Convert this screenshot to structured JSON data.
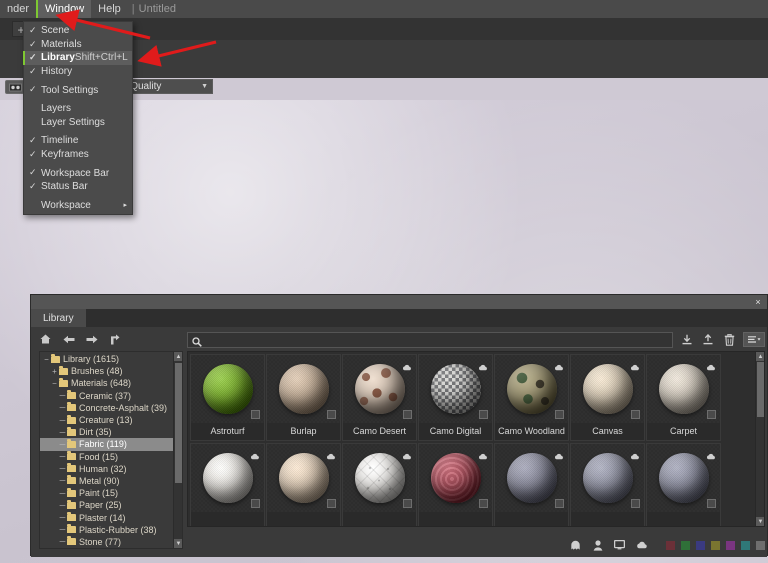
{
  "menubar": {
    "items": [
      {
        "label": "nder",
        "active": false
      },
      {
        "label": "Window",
        "active": true
      },
      {
        "label": "Help",
        "active": false
      }
    ],
    "separator": "|",
    "document_title": "Untitled"
  },
  "toolbar": {
    "new_tab_label": "+",
    "camera_icon": "camera-icon",
    "quality_dropdown": {
      "value": "ll Quality",
      "caret": "▼"
    }
  },
  "window_menu": {
    "checkmark": "✓",
    "submenu_arrow": "▸",
    "items": [
      {
        "label": "Scene",
        "checked": true,
        "shortcut": "",
        "highlight": false,
        "separator_after": false
      },
      {
        "label": "Materials",
        "checked": true,
        "shortcut": "",
        "highlight": false,
        "separator_after": false
      },
      {
        "label": "Library",
        "checked": true,
        "shortcut": "Shift+Ctrl+L",
        "highlight": true,
        "separator_after": false
      },
      {
        "label": "History",
        "checked": true,
        "shortcut": "",
        "highlight": false,
        "separator_after": true
      },
      {
        "label": "Tool Settings",
        "checked": true,
        "shortcut": "",
        "highlight": false,
        "separator_after": true
      },
      {
        "label": "Layers",
        "checked": false,
        "shortcut": "",
        "highlight": false,
        "separator_after": false
      },
      {
        "label": "Layer Settings",
        "checked": false,
        "shortcut": "",
        "highlight": false,
        "separator_after": true
      },
      {
        "label": "Timeline",
        "checked": true,
        "shortcut": "",
        "highlight": false,
        "separator_after": false
      },
      {
        "label": "Keyframes",
        "checked": true,
        "shortcut": "",
        "highlight": false,
        "separator_after": true
      },
      {
        "label": "Workspace Bar",
        "checked": true,
        "shortcut": "",
        "highlight": false,
        "separator_after": false
      },
      {
        "label": "Status Bar",
        "checked": true,
        "shortcut": "",
        "highlight": false,
        "separator_after": true
      },
      {
        "label": "Workspace",
        "checked": false,
        "shortcut": "",
        "highlight": false,
        "submenu": true,
        "separator_after": false
      }
    ]
  },
  "annotations": {
    "arrow_color": "#e01b1b",
    "arrow_1_target": "Window menu",
    "arrow_2_target": "Library menu item"
  },
  "library_window": {
    "close_label": "×",
    "tab_label": "Library",
    "nav_icons": [
      {
        "name": "home-icon"
      },
      {
        "name": "back-arrow-icon"
      },
      {
        "name": "forward-arrow-icon"
      },
      {
        "name": "up-level-icon"
      }
    ],
    "search": {
      "value": "",
      "placeholder": "",
      "icon": "search-icon"
    },
    "actions": [
      {
        "name": "download-icon"
      },
      {
        "name": "upload-icon"
      },
      {
        "name": "trash-icon"
      },
      {
        "name": "view-options-icon"
      }
    ],
    "tree": [
      {
        "label": "Library (1615)",
        "depth": 0,
        "twist": "−",
        "selected": false
      },
      {
        "label": "Brushes (48)",
        "depth": 1,
        "twist": "+",
        "selected": false
      },
      {
        "label": "Materials (648)",
        "depth": 1,
        "twist": "−",
        "selected": false
      },
      {
        "label": "Ceramic (37)",
        "depth": 2,
        "twist": "",
        "selected": false
      },
      {
        "label": "Concrete-Asphalt (39)",
        "depth": 2,
        "twist": "",
        "selected": false
      },
      {
        "label": "Creature (13)",
        "depth": 2,
        "twist": "",
        "selected": false
      },
      {
        "label": "Dirt (35)",
        "depth": 2,
        "twist": "",
        "selected": false
      },
      {
        "label": "Fabric (119)",
        "depth": 2,
        "twist": "",
        "selected": true
      },
      {
        "label": "Food (15)",
        "depth": 2,
        "twist": "",
        "selected": false
      },
      {
        "label": "Human (32)",
        "depth": 2,
        "twist": "",
        "selected": false
      },
      {
        "label": "Metal (90)",
        "depth": 2,
        "twist": "",
        "selected": false
      },
      {
        "label": "Paint (15)",
        "depth": 2,
        "twist": "",
        "selected": false
      },
      {
        "label": "Paper (25)",
        "depth": 2,
        "twist": "",
        "selected": false
      },
      {
        "label": "Plaster (14)",
        "depth": 2,
        "twist": "",
        "selected": false
      },
      {
        "label": "Plastic-Rubber (38)",
        "depth": 2,
        "twist": "",
        "selected": false
      },
      {
        "label": "Stone (77)",
        "depth": 2,
        "twist": "",
        "selected": false
      }
    ],
    "materials": [
      {
        "label": "Astroturf",
        "color": "#7aad2e",
        "cloud": false,
        "checkbox": true,
        "texture": "noise"
      },
      {
        "label": "Burlap",
        "color": "#c2ad97",
        "cloud": false,
        "checkbox": true,
        "texture": "noise"
      },
      {
        "label": "Camo Desert",
        "color": "#cdbdae",
        "cloud": true,
        "checkbox": true,
        "texture": "camo-desert"
      },
      {
        "label": "Camo Digital",
        "color": "#b4b3ad",
        "cloud": true,
        "checkbox": true,
        "texture": "camo-digital"
      },
      {
        "label": "Camo Woodland",
        "color": "#98906f",
        "cloud": true,
        "checkbox": true,
        "texture": "camo-woodland"
      },
      {
        "label": "Canvas",
        "color": "#d6c9b4",
        "cloud": true,
        "checkbox": true,
        "texture": "noise"
      },
      {
        "label": "Carpet",
        "color": "#cfc7bb",
        "cloud": true,
        "checkbox": true,
        "texture": "noise"
      },
      {
        "label": "",
        "color": "#e3e0db",
        "cloud": true,
        "checkbox": true,
        "texture": "noise"
      },
      {
        "label": "",
        "color": "#dbc9b4",
        "cloud": true,
        "checkbox": true,
        "texture": "noise"
      },
      {
        "label": "",
        "color": "#e6e4e1",
        "cloud": true,
        "checkbox": true,
        "texture": "tufted"
      },
      {
        "label": "",
        "color": "#b0525f",
        "cloud": true,
        "checkbox": true,
        "texture": "rings"
      },
      {
        "label": "",
        "color": "#8a8b9c",
        "cloud": true,
        "checkbox": true,
        "texture": "noise"
      },
      {
        "label": "",
        "color": "#9193a3",
        "cloud": true,
        "checkbox": true,
        "texture": "noise"
      },
      {
        "label": "",
        "color": "#8e90a1",
        "cloud": true,
        "checkbox": true,
        "texture": "noise"
      }
    ],
    "status_icons": [
      {
        "name": "ghost-icon"
      },
      {
        "name": "person-icon"
      },
      {
        "name": "monitor-icon"
      },
      {
        "name": "cloud-icon"
      }
    ],
    "color_swatches": [
      {
        "name": "swatch-red",
        "color": "#6b3038"
      },
      {
        "name": "swatch-green",
        "color": "#2f7038"
      },
      {
        "name": "swatch-blue",
        "color": "#3a3a80"
      },
      {
        "name": "swatch-olive",
        "color": "#7a7530"
      },
      {
        "name": "swatch-purple",
        "color": "#7a3580"
      },
      {
        "name": "swatch-teal",
        "color": "#2f7878"
      },
      {
        "name": "swatch-gray",
        "color": "#6e6e6e"
      }
    ]
  }
}
